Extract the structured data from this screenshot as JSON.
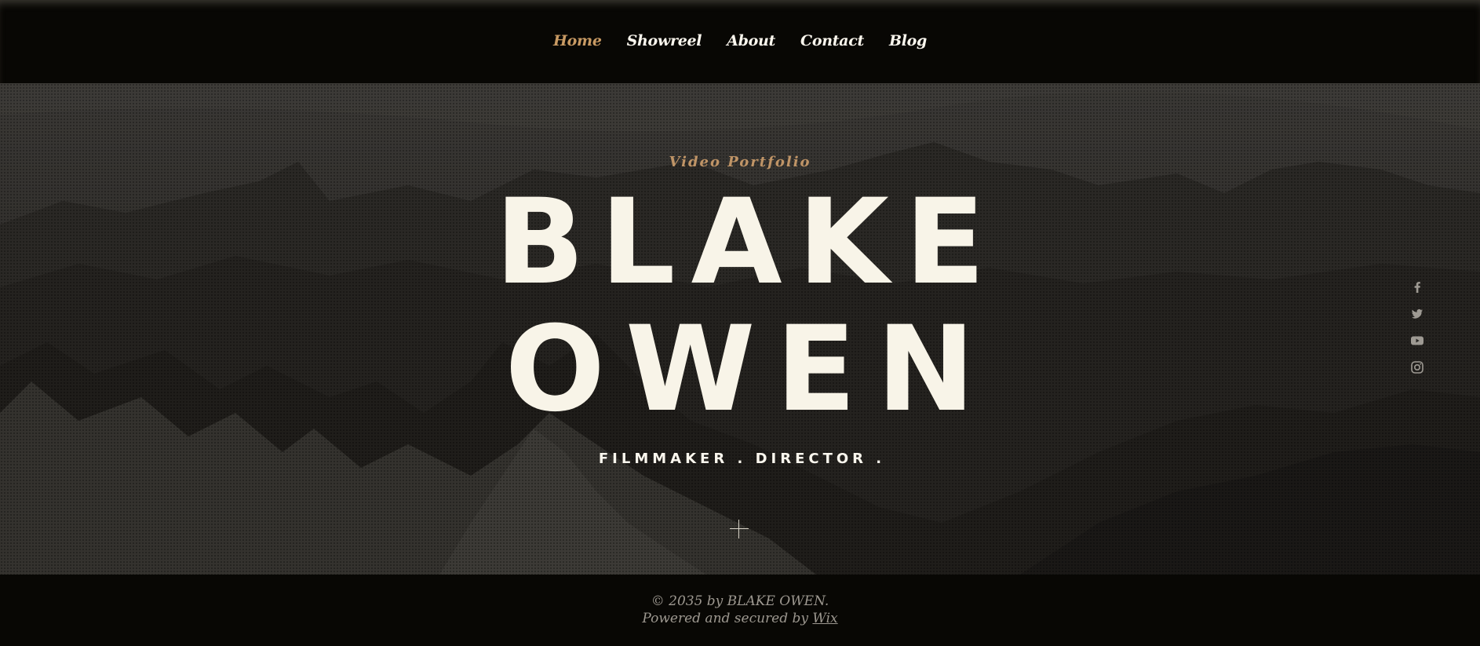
{
  "nav": {
    "items": [
      {
        "label": "Home",
        "active": true
      },
      {
        "label": "Showreel",
        "active": false
      },
      {
        "label": "About",
        "active": false
      },
      {
        "label": "Contact",
        "active": false
      },
      {
        "label": "Blog",
        "active": false
      }
    ]
  },
  "hero": {
    "kicker": "Video Portfolio",
    "name_line_1": "BLAKE",
    "name_line_2": "OWEN",
    "role": "FILMMAKER . DIRECTOR .",
    "expand_icon": "plus-icon"
  },
  "social": [
    "facebook-icon",
    "twitter-icon",
    "youtube-icon",
    "instagram-icon"
  ],
  "footer": {
    "copyright": "© 2035 by BLAKE OWEN.",
    "powered_prefix": "Powered and secured by ",
    "powered_link": "Wix"
  },
  "colors": {
    "accent": "#c89a63",
    "text_light": "#f8f4e8",
    "background": "#080704",
    "footer_text": "#9d9890"
  }
}
